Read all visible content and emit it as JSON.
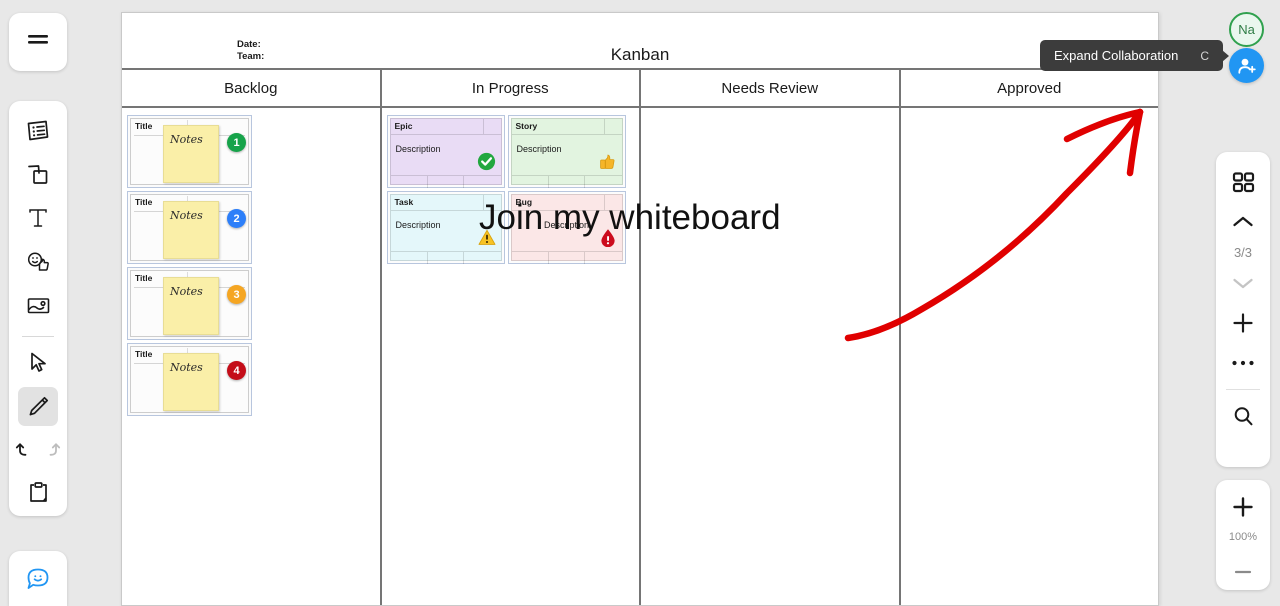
{
  "app": {
    "left_toolbar": {
      "menu_label": "Menu",
      "tools": [
        {
          "name": "templates-tool",
          "icon": "templates-icon",
          "active": false
        },
        {
          "name": "shapes-tool",
          "icon": "shapes-icon",
          "active": false
        },
        {
          "name": "text-tool",
          "icon": "text-icon",
          "label": "T",
          "active": false
        },
        {
          "name": "reactions-tool",
          "icon": "reactions-icon",
          "active": false
        },
        {
          "name": "image-tool",
          "icon": "image-icon",
          "active": false
        },
        {
          "name": "select-tool",
          "icon": "cursor-icon",
          "active": false
        },
        {
          "name": "pen-tool",
          "icon": "pencil-icon",
          "active": true
        }
      ],
      "undo_label": "Undo",
      "redo_label": "Redo",
      "clipboard_label": "Clipboard",
      "chat_label": "Chat"
    },
    "tooltip": {
      "text": "Expand Collaboration",
      "shortcut": "C"
    },
    "avatar": {
      "initials": "Na",
      "border_color": "#30a14e",
      "bg_color": "#eaf7ee"
    },
    "invite": {
      "label": "Invite",
      "color": "#2196f3"
    },
    "right_panel": {
      "frames_label": "Frames",
      "prev_label": "Previous frame",
      "counter": "3/3",
      "next_label": "Next frame",
      "add_label": "Add",
      "more_label": "More",
      "search_label": "Search"
    },
    "zoom": {
      "in_label": "Zoom in",
      "level": "100%",
      "out_label": "Zoom out"
    }
  },
  "board": {
    "title": "Kanban",
    "meta": {
      "date_label": "Date:",
      "team_label": "Team:"
    },
    "columns": [
      {
        "header": "Backlog"
      },
      {
        "header": "In Progress"
      },
      {
        "header": "Needs Review"
      },
      {
        "header": "Approved"
      }
    ],
    "backlog_cards": [
      {
        "title": "Title",
        "note": "Notes",
        "badge": "1",
        "badge_color": "#16a34a"
      },
      {
        "title": "Title",
        "note": "Notes",
        "badge": "2",
        "badge_color": "#2d7ff9"
      },
      {
        "title": "Title",
        "note": "Notes",
        "badge": "3",
        "badge_color": "#f5a623"
      },
      {
        "title": "Title",
        "note": "Notes",
        "badge": "4",
        "badge_color": "#c40d19"
      }
    ],
    "progress_cards": [
      {
        "type": "Epic",
        "body": "Description",
        "bg": "#e9dcf5",
        "icon": "check-circle-icon",
        "centered": false
      },
      {
        "type": "Story",
        "body": "Description",
        "bg": "#e2f4e0",
        "icon": "thumbs-up-icon",
        "centered": false
      },
      {
        "type": "Task",
        "body": "Description",
        "bg": "#e4f7fa",
        "icon": "warning-icon",
        "centered": false
      },
      {
        "type": "Bug",
        "body": "Description",
        "bg": "#fbe7e7",
        "icon": "alert-drop-icon",
        "centered": true
      }
    ],
    "annotation": {
      "text": "Join my whiteboard",
      "ink_color": "#e00000"
    }
  }
}
